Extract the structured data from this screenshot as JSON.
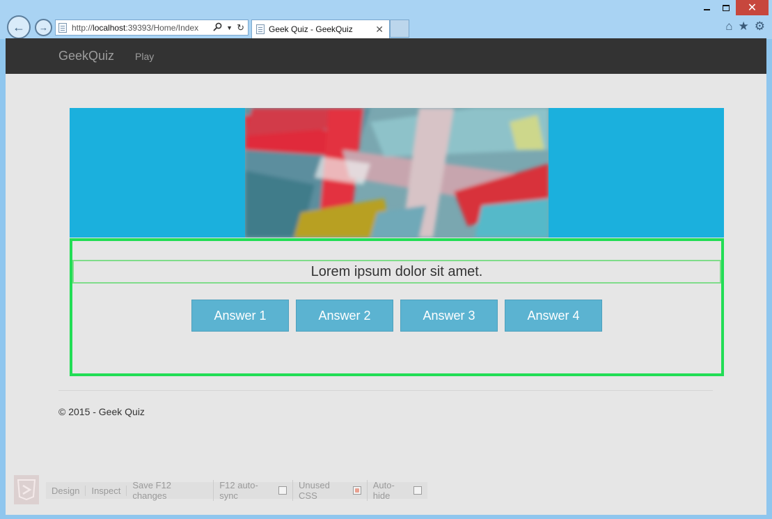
{
  "browser": {
    "address_url_prefix": "http://",
    "address_url_host": "localhost",
    "address_url_rest": ":39393/Home/Index",
    "tab_title": "Geek Quiz - GeekQuiz",
    "window_controls": {
      "minimize": "minimize-icon",
      "maximize": "maximize-icon",
      "close": "✕"
    }
  },
  "navbar": {
    "brand": "GeekQuiz",
    "links": [
      "Play"
    ]
  },
  "quiz": {
    "question": "Lorem ipsum dolor sit amet.",
    "answers": [
      "Answer 1",
      "Answer 2",
      "Answer 3",
      "Answer 4"
    ]
  },
  "footer": {
    "text": "© 2015 - Geek Quiz"
  },
  "browser_link_toolbar": {
    "items": [
      "Design",
      "Inspect",
      "Save F12 changes",
      "F12 auto-sync",
      "Unused CSS",
      "Auto-hide"
    ],
    "auto_sync_checked": false,
    "unused_css_checked": true,
    "auto_hide_checked": false
  },
  "colors": {
    "navbar_bg": "#333333",
    "hero_bg": "#1bb0dd",
    "answer_button_bg": "#5bb3d1",
    "highlight_border": "#22dd55",
    "page_bg": "#e6e6e6"
  }
}
